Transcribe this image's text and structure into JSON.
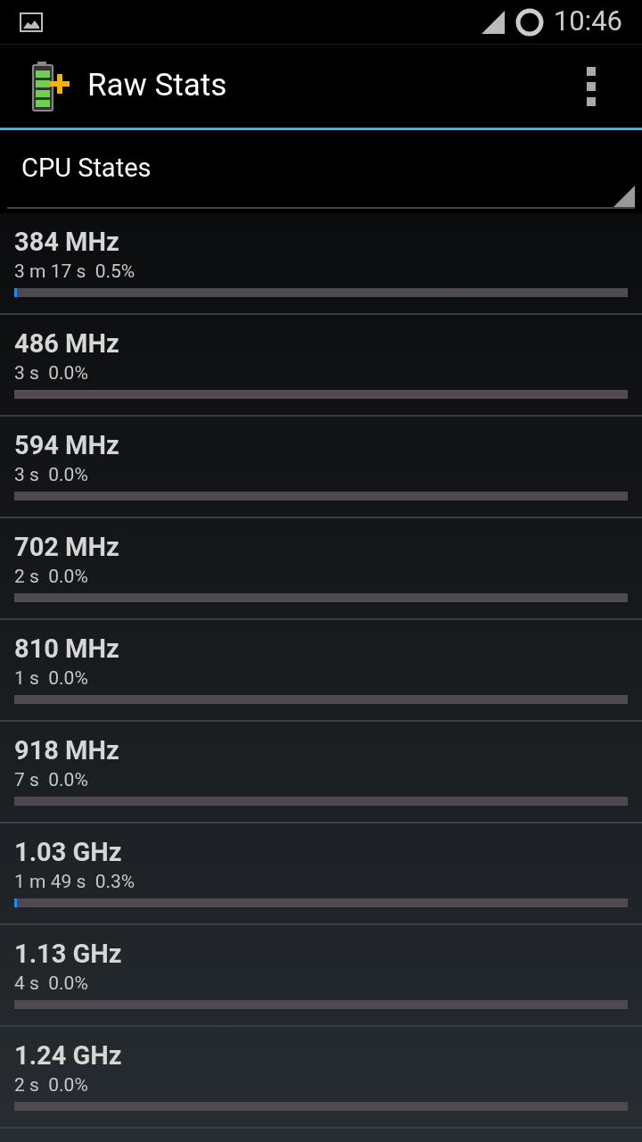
{
  "status_bar": {
    "time": "10:46"
  },
  "action_bar": {
    "title": "Raw Stats"
  },
  "spinner": {
    "value": "CPU States"
  },
  "states": [
    {
      "frequency": "384 MHz",
      "reading": "3 m 17 s  0.5%",
      "level": 0.005
    },
    {
      "frequency": "486 MHz",
      "reading": "3 s  0.0%"
    },
    {
      "frequency": "594 MHz",
      "reading": "3 s  0.0%"
    },
    {
      "frequency": "702 MHz",
      "reading": "2 s  0.0%"
    },
    {
      "frequency": "810 MHz",
      "reading": "1 s  0.0%"
    },
    {
      "frequency": "918 MHz",
      "reading": "7 s  0.0%"
    },
    {
      "frequency": "1.03 GHz",
      "reading": "1 m 49 s  0.3%",
      "level": 0.003
    },
    {
      "frequency": "1.13 GHz",
      "reading": "4 s  0.0%"
    },
    {
      "frequency": "1.24 GHz",
      "reading": "2 s  0.0%"
    }
  ]
}
